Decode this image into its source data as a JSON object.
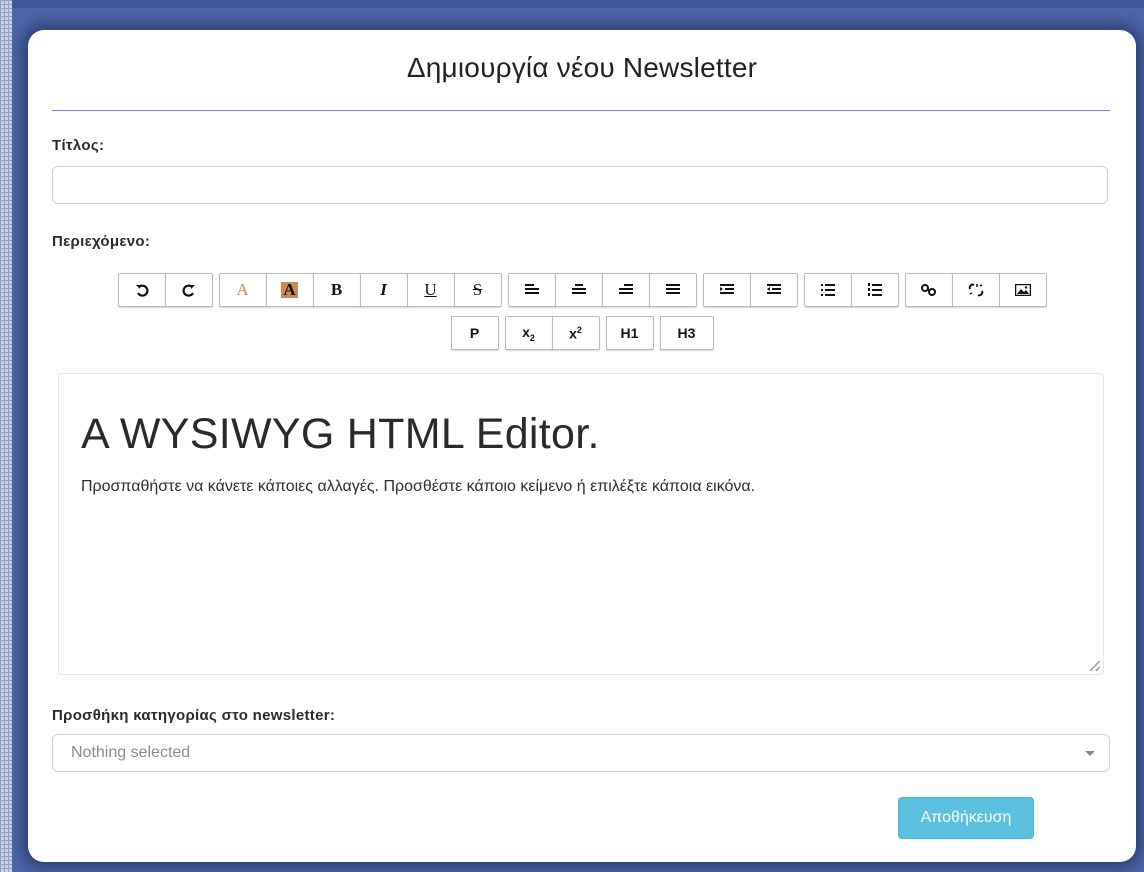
{
  "modal": {
    "title": "Δημιουργία νέου Newsletter"
  },
  "form": {
    "title_label": "Τίτλος:",
    "title_value": "",
    "content_label": "Περιεχόμενο:",
    "category_label": "Προσθήκη κατηγορίας στο newsletter:",
    "category_selected": "Nothing selected",
    "save_label": "Αποθήκευση"
  },
  "toolbar": {
    "forecolor": "A",
    "backcolor": "A",
    "bold": "B",
    "italic": "I",
    "underline": "U",
    "strike": "S",
    "paragraph": "P",
    "h1": "H1",
    "h3": "H3"
  },
  "editor": {
    "heading": "A WYSIWYG HTML Editor.",
    "paragraph": "Προσπαθήστε να κάνετε κάποιες αλλαγές. Προσθέστε κάποιο κείμενο ή επιλέξτε κάποια εικόνα."
  },
  "colors": {
    "accent_rule": "#7b7ff0",
    "save_button": "#5bc0de",
    "backdrop": "#4c68a8"
  }
}
